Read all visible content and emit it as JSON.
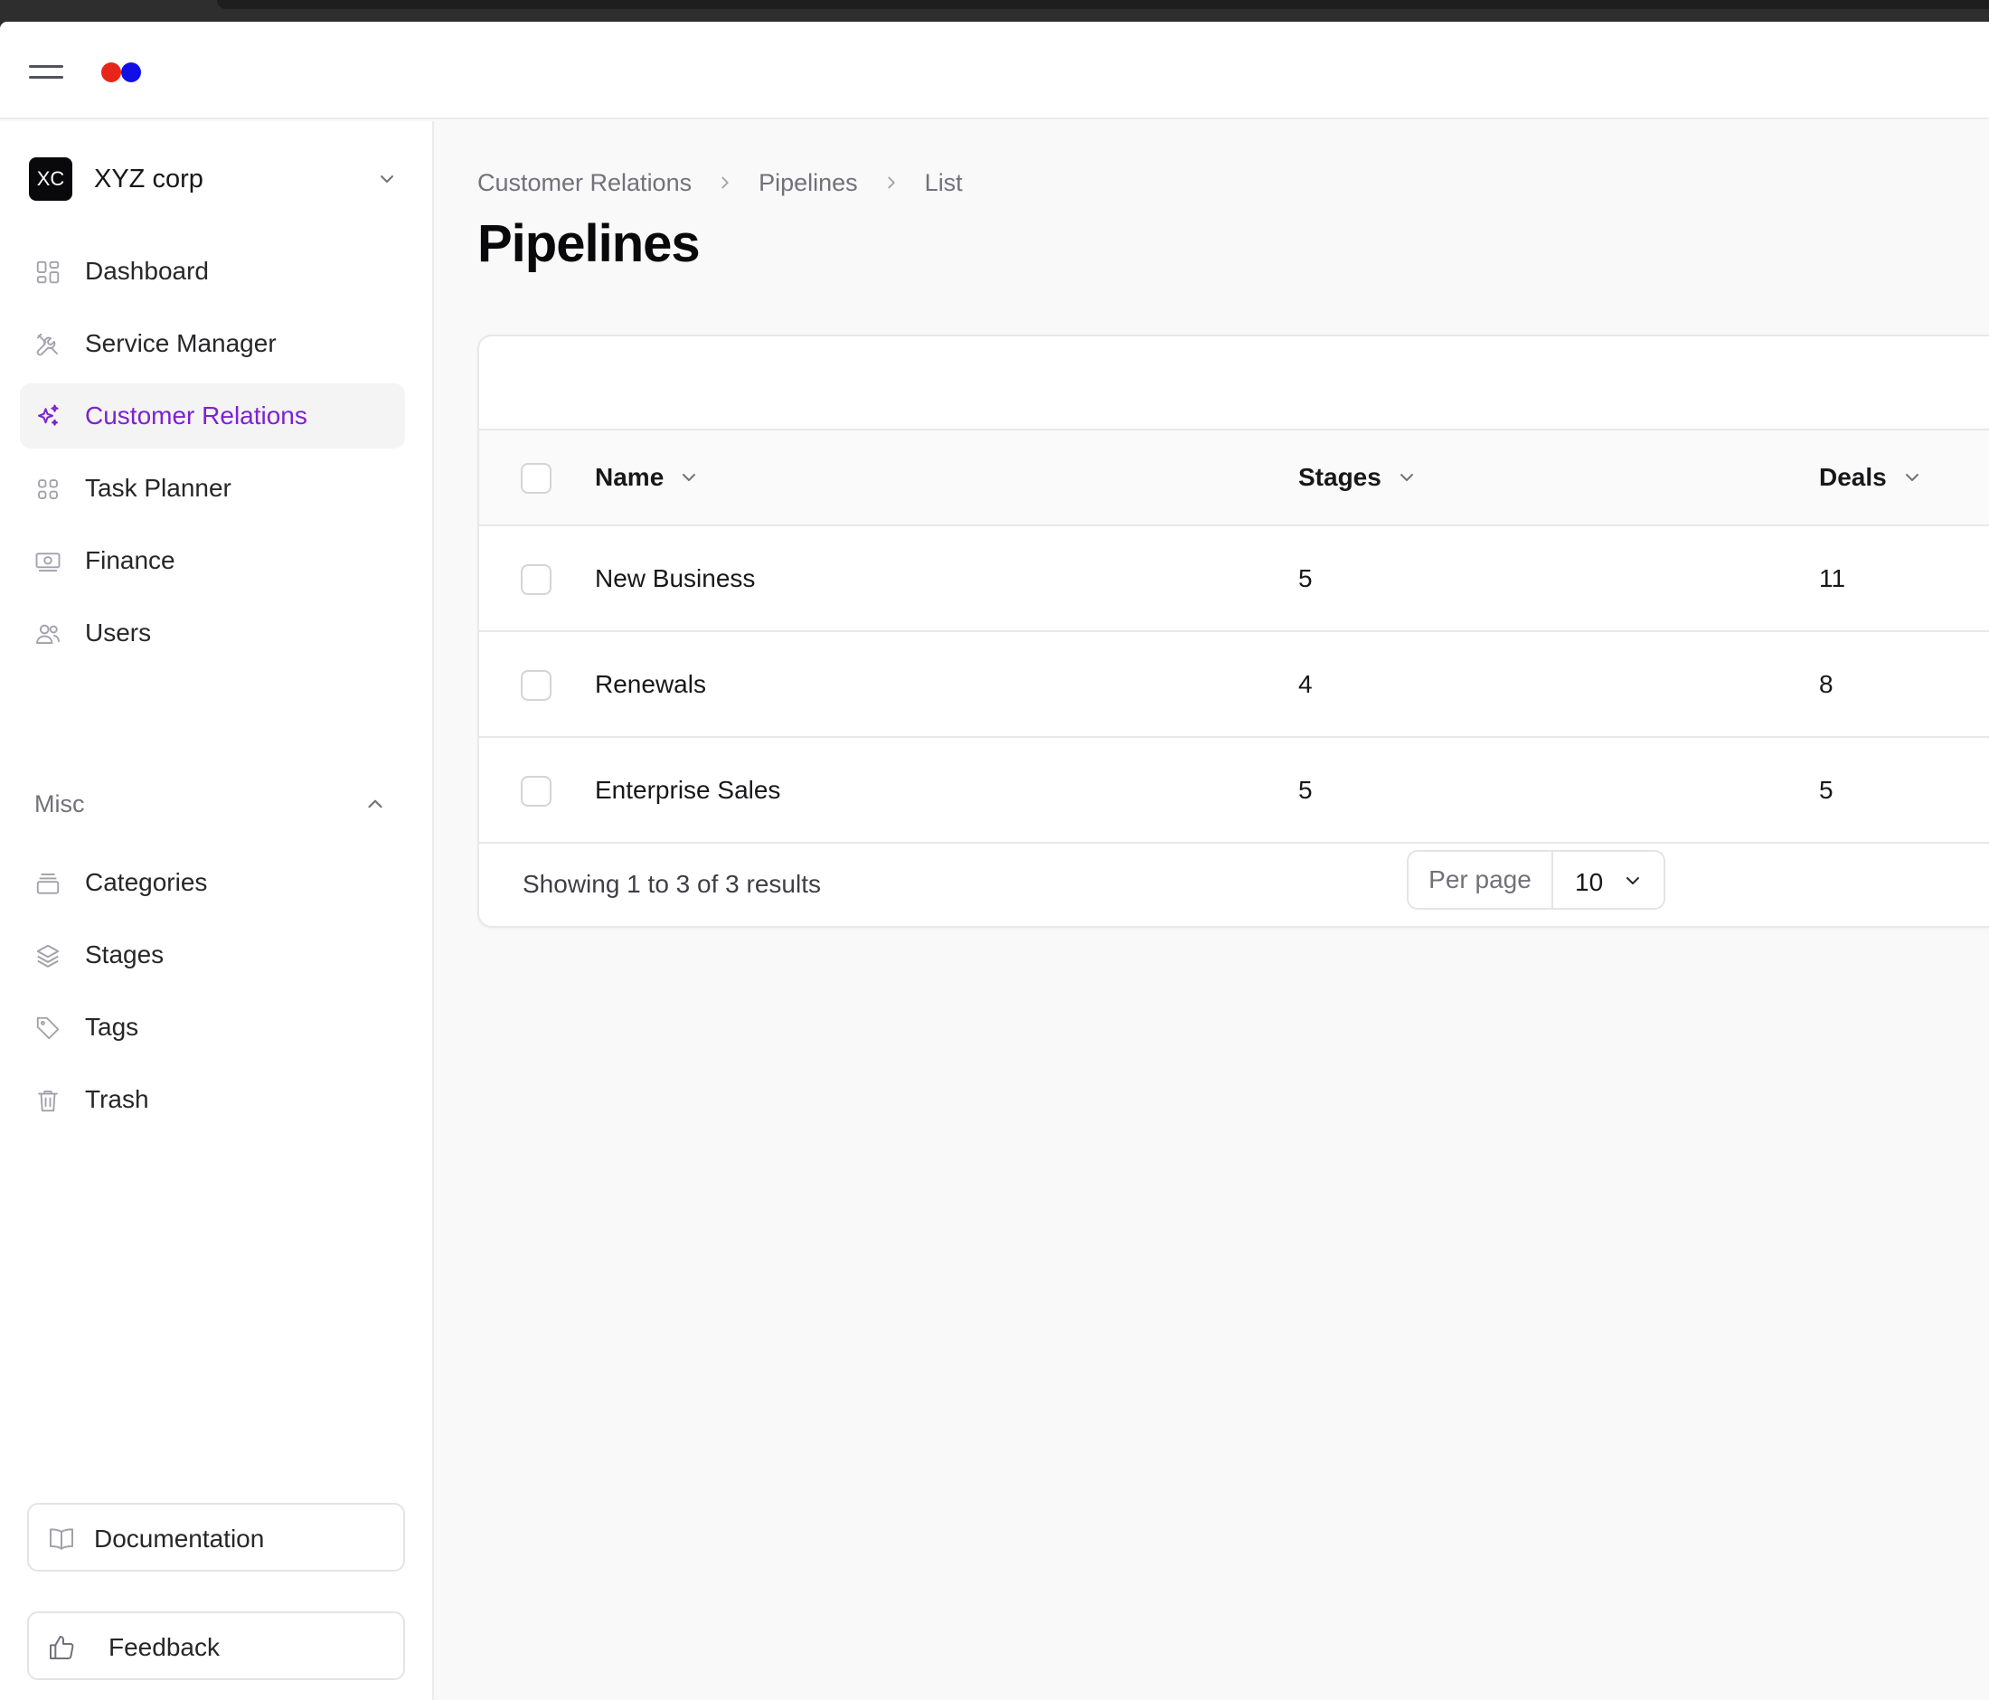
{
  "workspace": {
    "initials": "XC",
    "name": "XYZ corp"
  },
  "sidebar": {
    "items": [
      {
        "label": "Dashboard",
        "icon": "dashboard-icon"
      },
      {
        "label": "Service Manager",
        "icon": "tools-icon"
      },
      {
        "label": "Customer Relations",
        "icon": "sparkles-icon",
        "active": true
      },
      {
        "label": "Task Planner",
        "icon": "grid-icon"
      },
      {
        "label": "Finance",
        "icon": "banknote-icon"
      },
      {
        "label": "Users",
        "icon": "users-icon"
      }
    ],
    "group": {
      "label": "Misc",
      "expanded": true,
      "items": [
        {
          "label": "Categories",
          "icon": "archive-icon"
        },
        {
          "label": "Stages",
          "icon": "layers-icon"
        },
        {
          "label": "Tags",
          "icon": "tag-icon"
        },
        {
          "label": "Trash",
          "icon": "trash-icon"
        }
      ]
    },
    "documentation_label": "Documentation",
    "feedback_label": "Feedback"
  },
  "breadcrumb": [
    "Customer Relations",
    "Pipelines",
    "List"
  ],
  "page": {
    "title": "Pipelines"
  },
  "table": {
    "columns": [
      "Name",
      "Stages",
      "Deals"
    ],
    "rows": [
      {
        "name": "New Business",
        "stages": "5",
        "deals": "11"
      },
      {
        "name": "Renewals",
        "stages": "4",
        "deals": "8"
      },
      {
        "name": "Enterprise Sales",
        "stages": "5",
        "deals": "5"
      }
    ],
    "summary": "Showing 1 to 3 of 3 results",
    "per_page_label": "Per page",
    "per_page_value": "10"
  },
  "colors": {
    "accent": "#7e22ce",
    "logo_red": "#e8251a",
    "logo_blue": "#1010e6"
  }
}
